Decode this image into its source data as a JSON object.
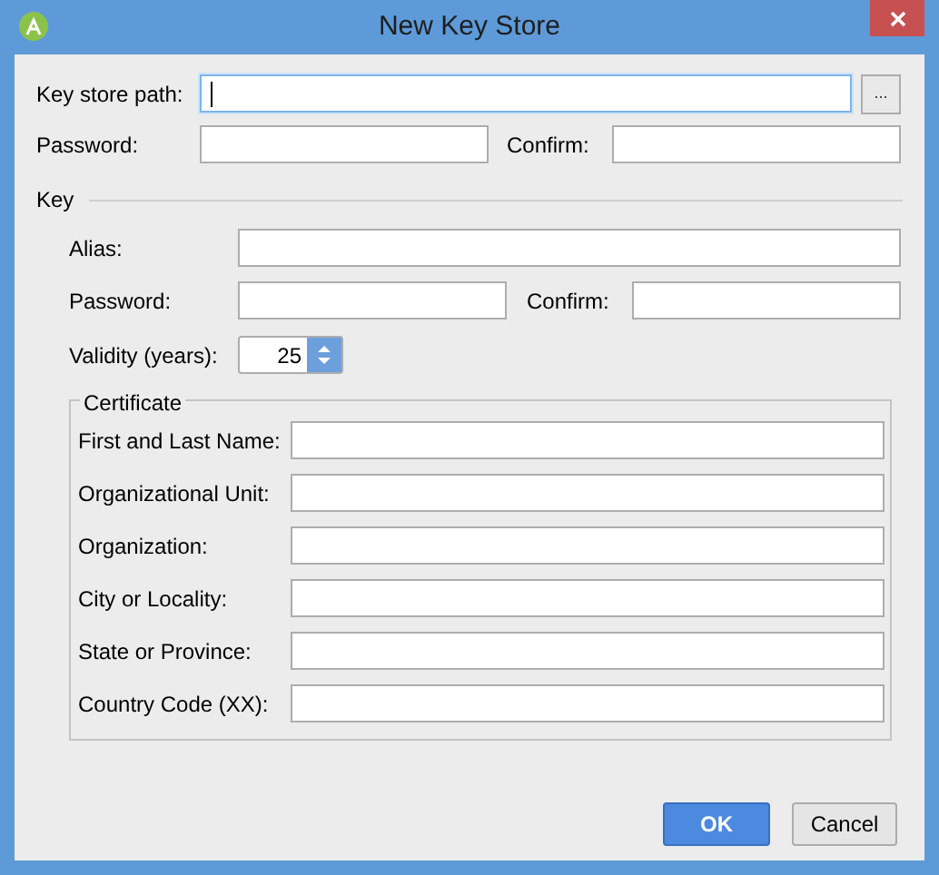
{
  "window": {
    "title": "New Key Store"
  },
  "key_store": {
    "path": {
      "label": "Key store path:",
      "focused": true
    },
    "browse_button": "...",
    "password": {
      "label": "Password:"
    },
    "confirm": {
      "label": "Confirm:"
    }
  },
  "key": {
    "heading": "Key",
    "alias": {
      "label": "Alias:"
    },
    "password": {
      "label": "Password:"
    },
    "confirm": {
      "label": "Confirm:"
    },
    "validity": {
      "label": "Validity (years):",
      "value": "25"
    },
    "certificate": {
      "legend": "Certificate",
      "fields": [
        {
          "label": "First and Last Name:"
        },
        {
          "label": "Organizational Unit:"
        },
        {
          "label": "Organization:"
        },
        {
          "label": "City or Locality:"
        },
        {
          "label": "State or Province:"
        },
        {
          "label": "Country Code (XX):"
        }
      ]
    }
  },
  "buttons": [
    {
      "label": "OK",
      "default": true
    },
    {
      "label": "Cancel",
      "default": false
    }
  ]
}
